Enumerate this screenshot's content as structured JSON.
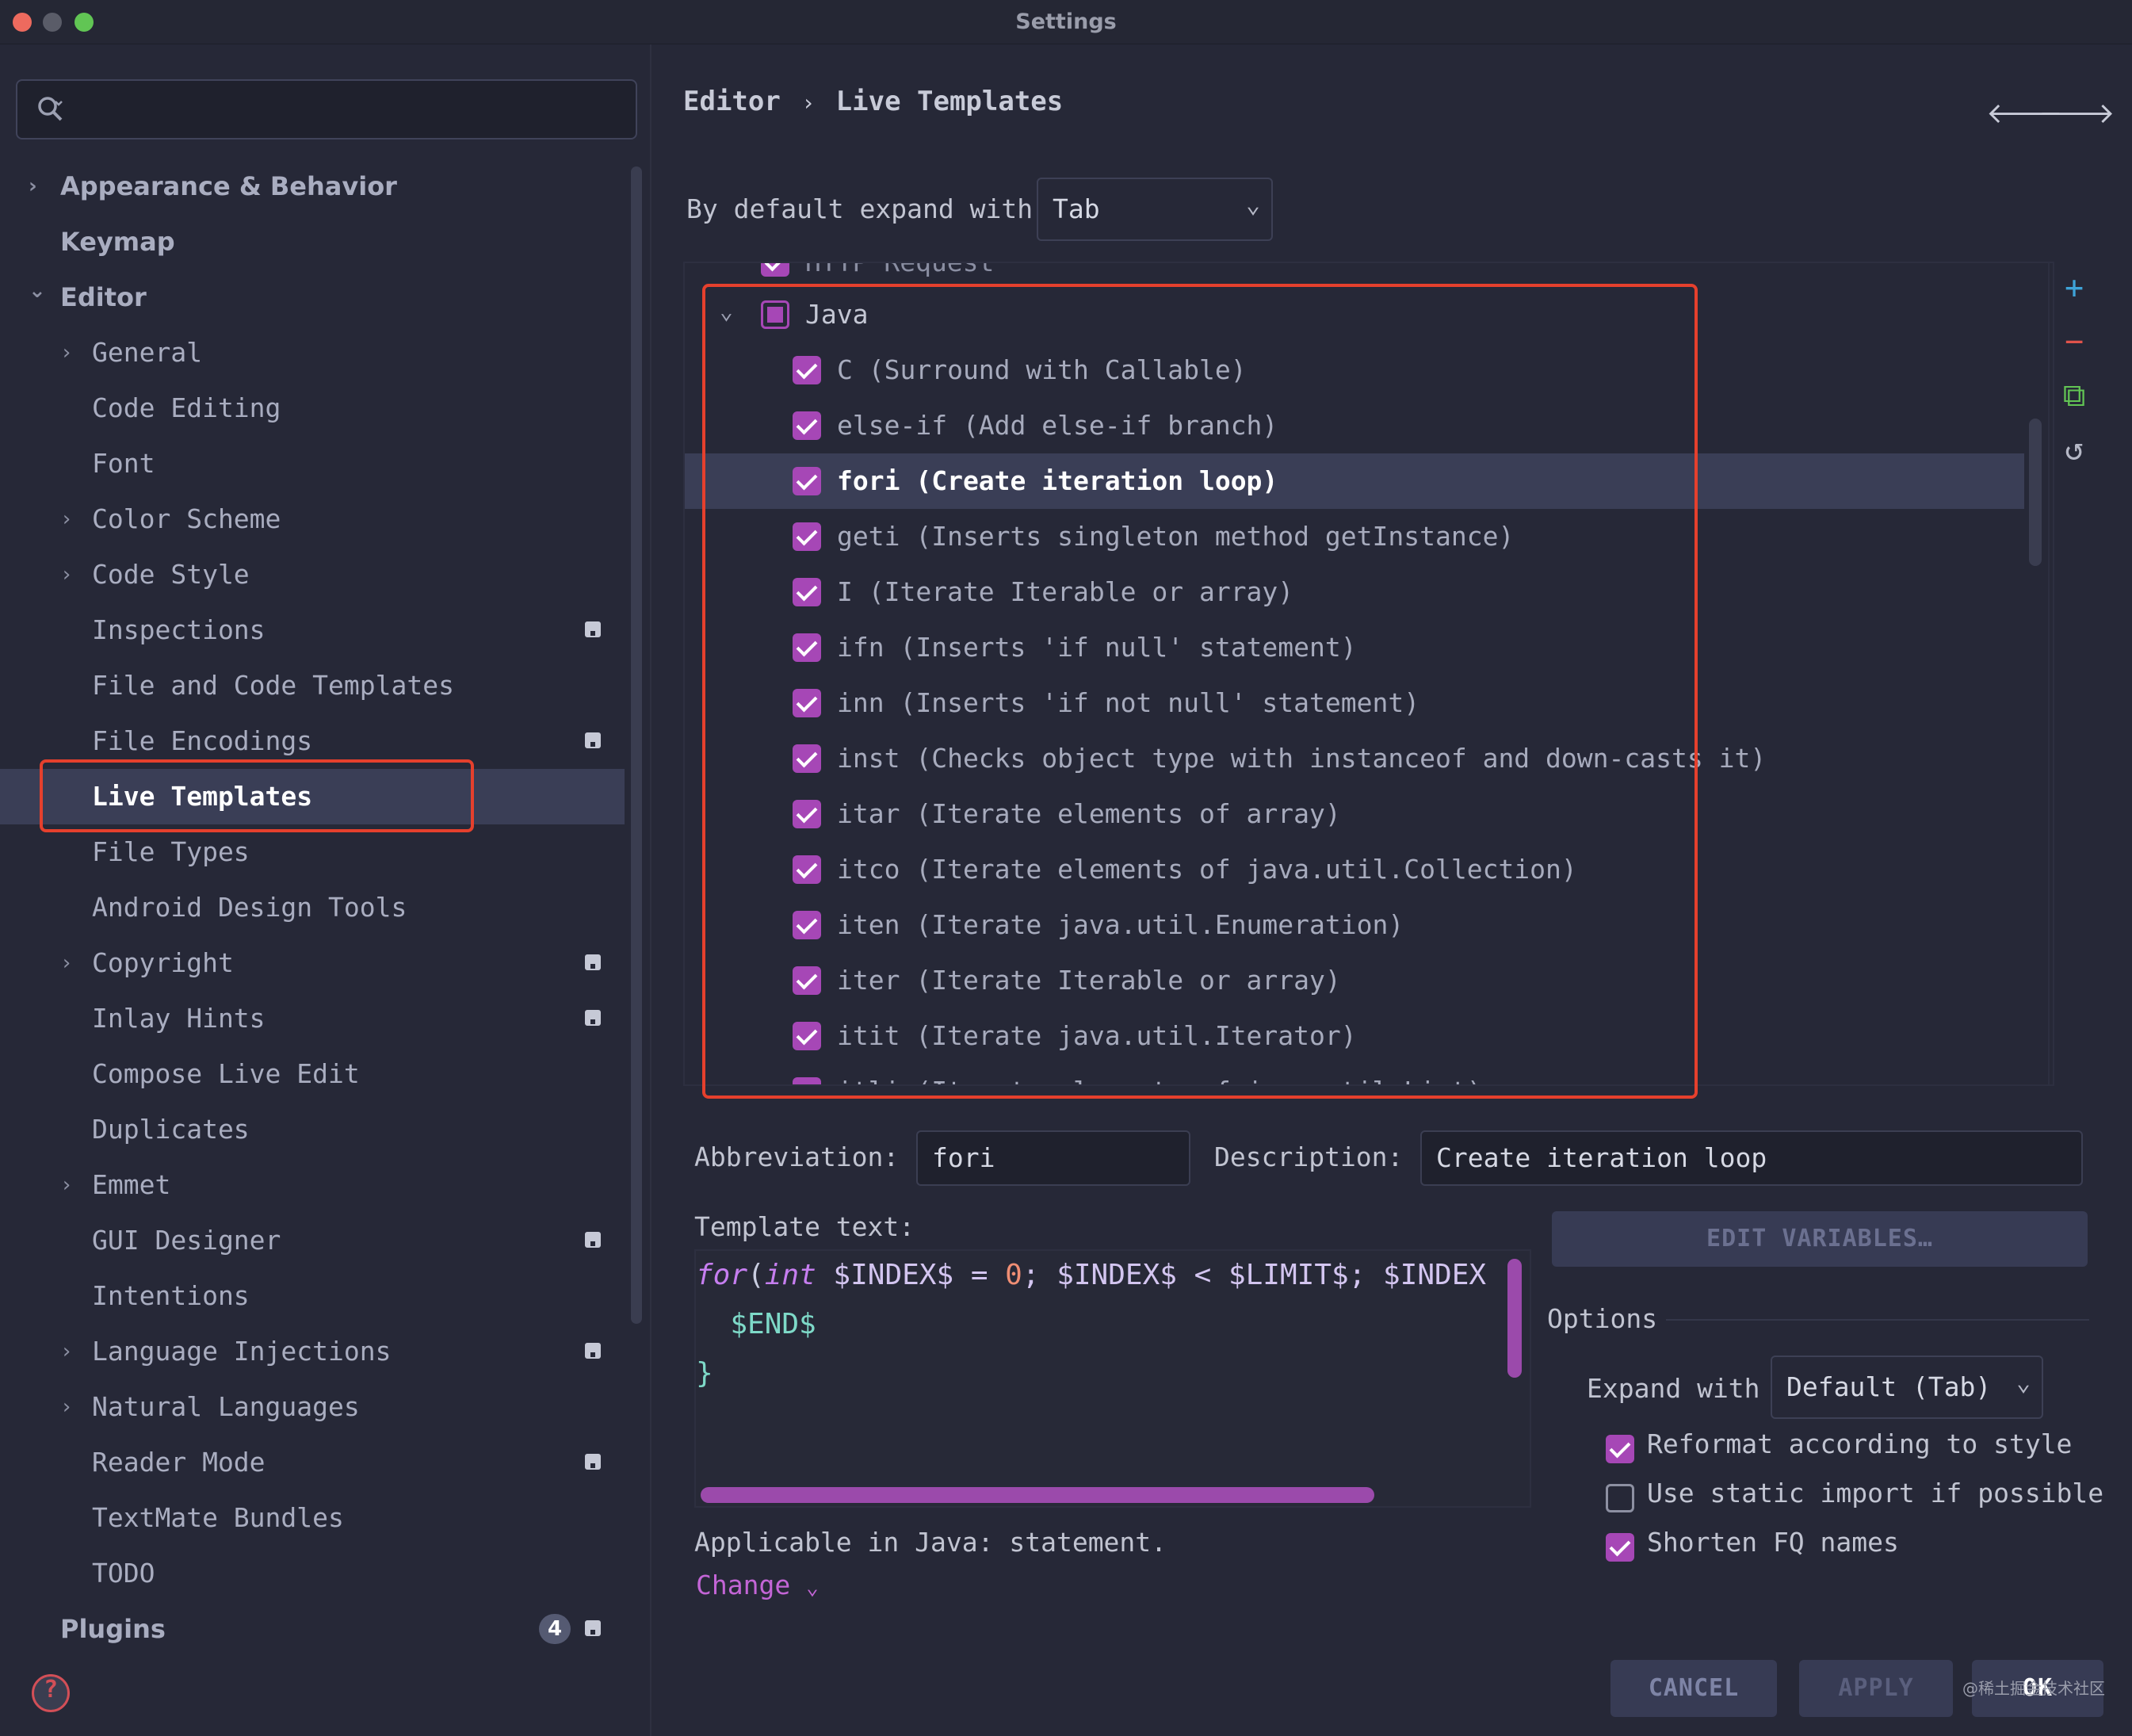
{
  "window": {
    "title": "Settings"
  },
  "sidebar": {
    "search_placeholder": "",
    "items": [
      {
        "label": "Appearance & Behavior",
        "arrow": "›",
        "pinned": false
      },
      {
        "label": "Keymap",
        "arrow": "",
        "pinned": false
      },
      {
        "label": "Editor",
        "arrow": "⌄",
        "pinned": false
      },
      {
        "label": "General",
        "arrow": "›",
        "pinned": false
      },
      {
        "label": "Code Editing",
        "arrow": "",
        "pinned": false
      },
      {
        "label": "Font",
        "arrow": "",
        "pinned": false
      },
      {
        "label": "Color Scheme",
        "arrow": "›",
        "pinned": false
      },
      {
        "label": "Code Style",
        "arrow": "›",
        "pinned": false
      },
      {
        "label": "Inspections",
        "arrow": "",
        "pinned": true
      },
      {
        "label": "File and Code Templates",
        "arrow": "",
        "pinned": false
      },
      {
        "label": "File Encodings",
        "arrow": "",
        "pinned": true
      },
      {
        "label": "Live Templates",
        "arrow": "",
        "pinned": false
      },
      {
        "label": "File Types",
        "arrow": "",
        "pinned": false
      },
      {
        "label": "Android Design Tools",
        "arrow": "",
        "pinned": false
      },
      {
        "label": "Copyright",
        "arrow": "›",
        "pinned": true
      },
      {
        "label": "Inlay Hints",
        "arrow": "",
        "pinned": true
      },
      {
        "label": "Compose Live Edit",
        "arrow": "",
        "pinned": false
      },
      {
        "label": "Duplicates",
        "arrow": "",
        "pinned": false
      },
      {
        "label": "Emmet",
        "arrow": "›",
        "pinned": false
      },
      {
        "label": "GUI Designer",
        "arrow": "",
        "pinned": true
      },
      {
        "label": "Intentions",
        "arrow": "",
        "pinned": false
      },
      {
        "label": "Language Injections",
        "arrow": "›",
        "pinned": true
      },
      {
        "label": "Natural Languages",
        "arrow": "›",
        "pinned": false
      },
      {
        "label": "Reader Mode",
        "arrow": "",
        "pinned": true
      },
      {
        "label": "TextMate Bundles",
        "arrow": "",
        "pinned": false
      },
      {
        "label": "TODO",
        "arrow": "",
        "pinned": false
      },
      {
        "label": "Plugins",
        "arrow": "",
        "pinned": true,
        "badge": "4"
      }
    ]
  },
  "breadcrumb": {
    "parent": "Editor",
    "separator": "›",
    "current": "Live Templates"
  },
  "nav_arrows": {
    "back": "🡐",
    "forward": "🡒"
  },
  "expand": {
    "label": "By default expand with",
    "value": "Tab",
    "chevron": "⌄"
  },
  "templates": {
    "partial_top": "HTTP Request",
    "group": "Java",
    "group_arrow": "⌄",
    "items": [
      {
        "text": "C (Surround with Callable)"
      },
      {
        "text": "else-if (Add else-if branch)"
      },
      {
        "text": "fori (Create iteration loop)",
        "selected": true
      },
      {
        "text": "geti (Inserts singleton method getInstance)"
      },
      {
        "text": "I (Iterate Iterable or array)"
      },
      {
        "text": "ifn (Inserts 'if null' statement)"
      },
      {
        "text": "inn (Inserts 'if not null' statement)"
      },
      {
        "text": "inst (Checks object type with instanceof and down-casts it)"
      },
      {
        "text": "itar (Iterate elements of array)"
      },
      {
        "text": "itco (Iterate elements of java.util.Collection)"
      },
      {
        "text": "iten (Iterate java.util.Enumeration)"
      },
      {
        "text": "iter (Iterate Iterable or array)"
      },
      {
        "text": "itit (Iterate java.util.Iterator)"
      },
      {
        "text": "itli (Iterate elements of java.util.List)"
      }
    ]
  },
  "tools": {
    "add": "+",
    "remove": "−",
    "copy": "⧉",
    "restore": "↺"
  },
  "abbreviation": {
    "label": "Abbreviation:",
    "value": "fori"
  },
  "description": {
    "label": "Description:",
    "value": "Create iteration loop"
  },
  "template_text": {
    "label": "Template text:",
    "line1": {
      "kw1": "for",
      "p1": "(",
      "kw2": "int",
      "v1": " $INDEX$ = ",
      "n": "0",
      "rest": "; $INDEX$ < $LIMIT$; $INDEX"
    },
    "line2": "  $END$",
    "line3": "}"
  },
  "edit_variables": "EDIT VARIABLES…",
  "options": {
    "title": "Options",
    "expand_label": "Expand with",
    "expand_value": "Default (Tab)",
    "chevron": "⌄",
    "reformat": "Reformat according to style",
    "static_import": "Use static import if possible",
    "shorten": "Shorten FQ names"
  },
  "applicable": "Applicable in Java: statement.",
  "change": "Change",
  "change_chevron": "⌄",
  "buttons": {
    "cancel": "CANCEL",
    "apply": "APPLY",
    "ok": "OK"
  },
  "help_icon": "?",
  "watermark": "@稀土掘金技术社区",
  "colors": {
    "accent": "#a647b6",
    "selection": "#3a3e56",
    "highlight_box": "#e5402d"
  }
}
